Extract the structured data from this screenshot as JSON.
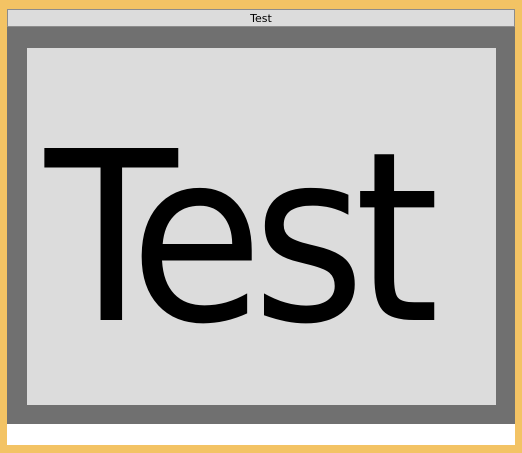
{
  "window": {
    "title": "Test",
    "frame_color": "#f3c364",
    "outer_background": "#707070",
    "inner_background": "#dcdcdc",
    "bottom_background": "#ffffff"
  },
  "content": {
    "text": "Test"
  }
}
